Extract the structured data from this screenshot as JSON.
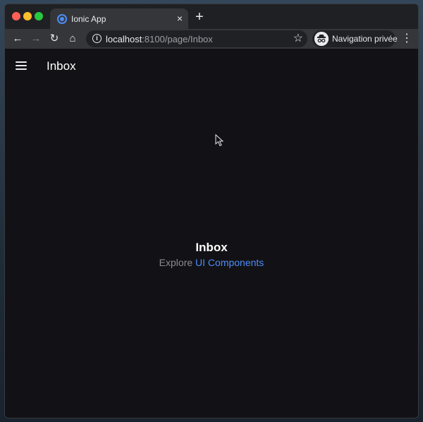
{
  "browser": {
    "tab": {
      "title": "Ionic App",
      "close_glyph": "×",
      "favicon": "ionic-logo-icon"
    },
    "new_tab_glyph": "+",
    "toolbar": {
      "back_icon": "←",
      "forward_icon": "→",
      "reload_icon": "↻",
      "home_icon": "⌂",
      "info_icon": "i",
      "url_host": "localhost",
      "url_rest": ":8100/page/Inbox",
      "star_icon": "☆",
      "incognito_label": "Navigation privée",
      "menu_icon": "⋮"
    }
  },
  "app": {
    "header_title": "Inbox",
    "content": {
      "title": "Inbox",
      "explore_text": "Explore",
      "link_text": "UI Components"
    }
  },
  "colors": {
    "background": "#121115",
    "link": "#4d8df6",
    "text": "#ffffff",
    "muted": "#8c8c8e"
  }
}
